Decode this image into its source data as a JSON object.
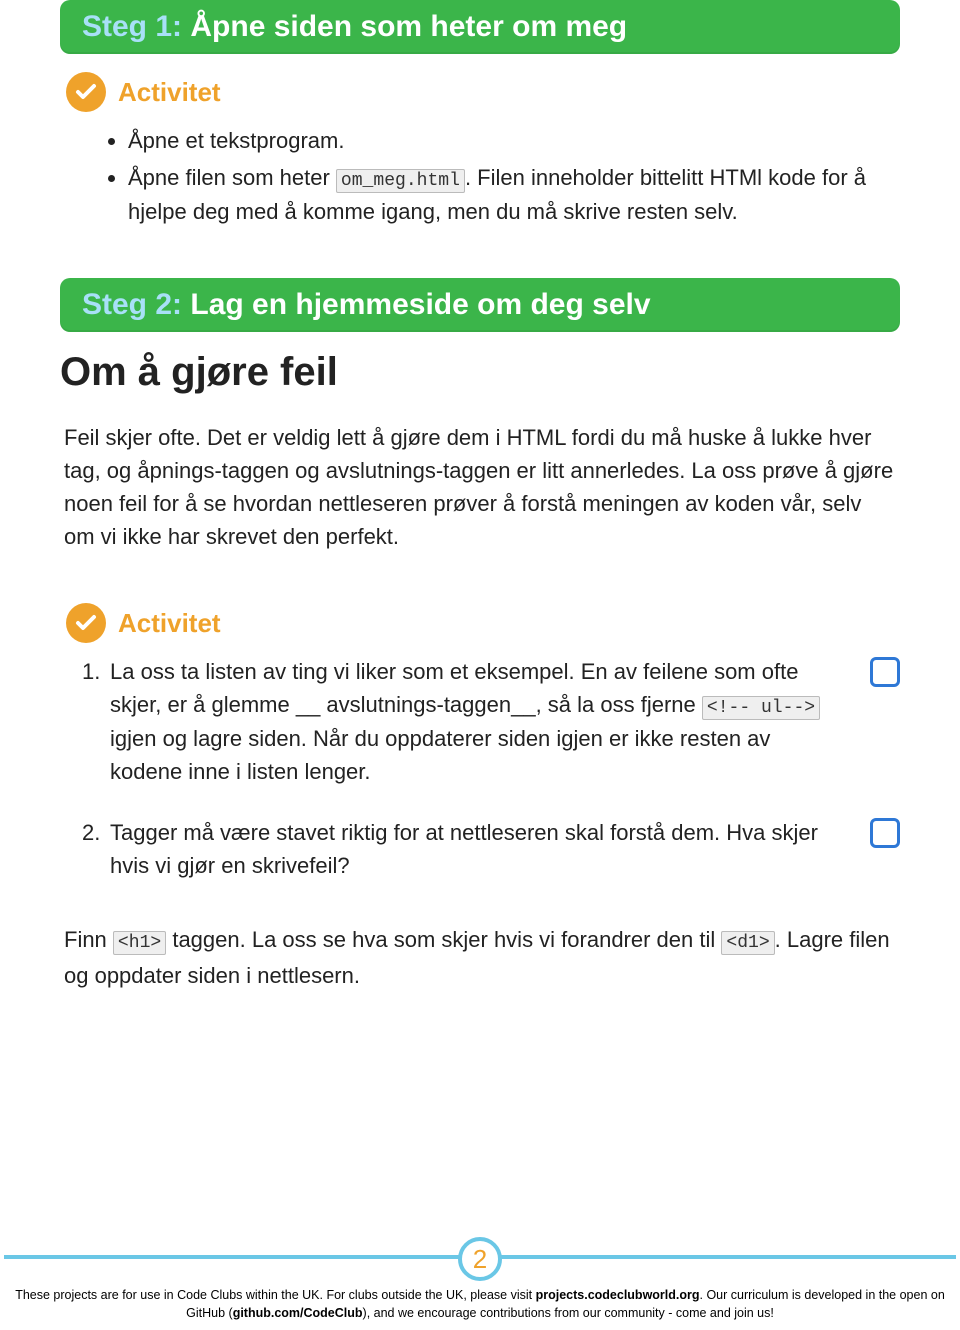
{
  "step1": {
    "label": "Steg 1:",
    "title": "Åpne siden som heter om meg"
  },
  "activity_label": "Activitet",
  "step1_bullets": {
    "b1": "Åpne et tekstprogram.",
    "b2_pre": "Åpne filen som heter ",
    "b2_code": "om_meg.html",
    "b2_post": ". Filen inneholder bittelitt HTMl kode for å hjelpe deg med å komme igang, men du må skrive resten selv."
  },
  "step2": {
    "label": "Steg 2:",
    "title": "Lag en hjemmeside om deg selv"
  },
  "subheading": "Om å gjøre feil",
  "para1": "Feil skjer ofte. Det er veldig lett å gjøre dem i HTML fordi du må huske å lukke hver tag, og åpnings-taggen og avslutnings-taggen er litt annerledes. La oss prøve å gjøre noen feil for å se hvordan nettleseren prøver å forstå meningen av koden vår, selv om vi ikke har skrevet den perfekt.",
  "numlist": {
    "i1_pre": "La oss ta listen av ting vi liker som et eksempel. En av feilene som ofte skjer, er å glemme __ avslutnings-taggen__, så la oss fjerne ",
    "i1_code": "<!-- ul-->",
    "i1_post": " igjen og lagre siden. Når du oppdaterer siden igjen er ikke resten av kodene inne i listen lenger.",
    "i2": "Tagger må være stavet riktig for at nettleseren skal forstå dem. Hva skjer hvis vi gjør en skrivefeil?"
  },
  "para2": {
    "p1": "Finn ",
    "c1": "<h1>",
    "p2": " taggen. La oss se hva som skjer hvis vi forandrer den til ",
    "c2": "<d1>",
    "p3": ". Lagre filen og oppdater siden i nettlesern."
  },
  "page_number": "2",
  "footer": {
    "line1a": "These projects are for use in Code Clubs within the UK. For clubs outside the UK, please visit ",
    "line1b": "projects.codeclubworld.org",
    "line1c": ". Our curriculum is developed in the open on GitHub (",
    "line1d": "github.com/CodeClub",
    "line1e": "), and we encourage contributions from our community - come and join us!"
  }
}
